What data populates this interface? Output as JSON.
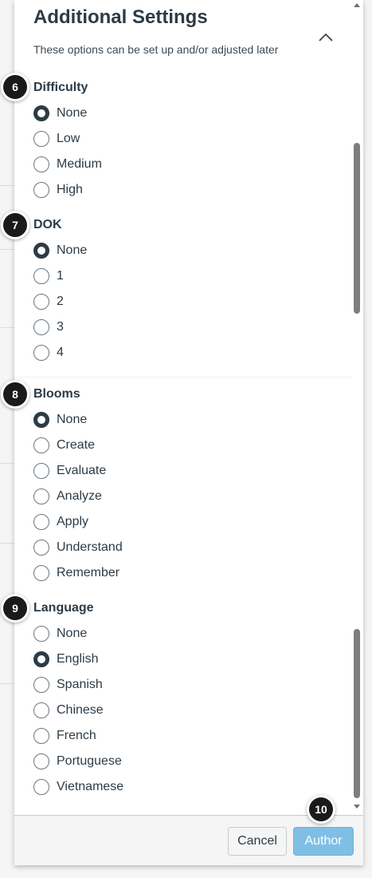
{
  "panel": {
    "title": "Additional Settings",
    "subtitle": "These options can be set up and/or adjusted later",
    "collapse_icon": "chevron-up-icon"
  },
  "sections": [
    {
      "badge": "6",
      "heading": "Difficulty",
      "options": [
        "None",
        "Low",
        "Medium",
        "High"
      ],
      "selected": "None"
    },
    {
      "badge": "7",
      "heading": "DOK",
      "options": [
        "None",
        "1",
        "2",
        "3",
        "4"
      ],
      "selected": "None"
    },
    {
      "badge": "8",
      "heading": "Blooms",
      "options": [
        "None",
        "Create",
        "Evaluate",
        "Analyze",
        "Apply",
        "Understand",
        "Remember"
      ],
      "selected": "None"
    },
    {
      "badge": "9",
      "heading": "Language",
      "options": [
        "None",
        "English",
        "Spanish",
        "Chinese",
        "French",
        "Portuguese",
        "Vietnamese"
      ],
      "selected": "English"
    }
  ],
  "footer": {
    "cancel_label": "Cancel",
    "author_label": "Author",
    "author_badge": "10"
  },
  "colors": {
    "text": "#2d3b45",
    "primary_button": "#7fbfe6",
    "badge": "#1a1a1a"
  }
}
